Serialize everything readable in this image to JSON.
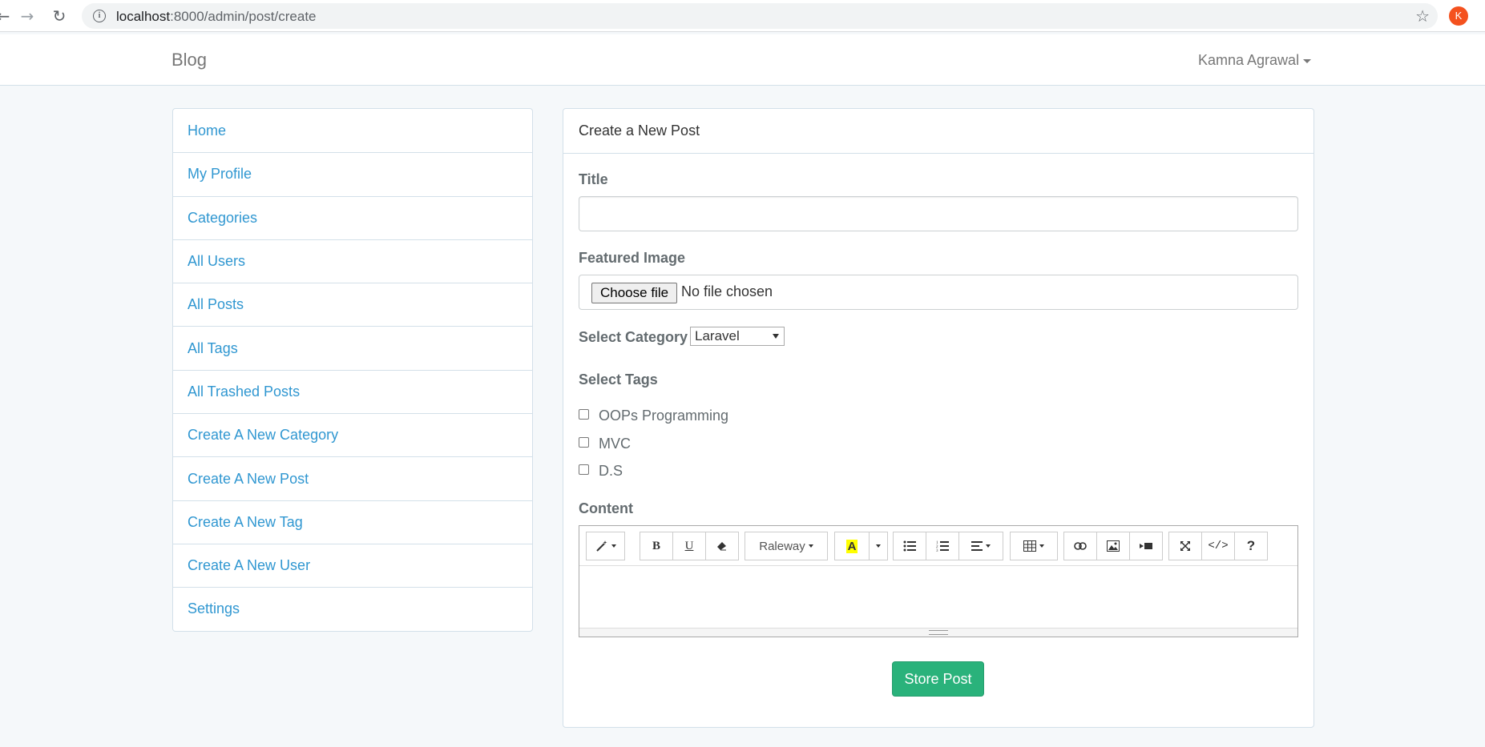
{
  "browser": {
    "url_host": "localhost",
    "url_path": ":8000/admin/post/create",
    "profile_initial": "K"
  },
  "navbar": {
    "brand": "Blog",
    "user_name": "Kamna Agrawal"
  },
  "sidebar": {
    "items": [
      {
        "label": "Home"
      },
      {
        "label": "My Profile"
      },
      {
        "label": "Categories"
      },
      {
        "label": "All Users"
      },
      {
        "label": "All Posts"
      },
      {
        "label": "All Tags"
      },
      {
        "label": "All Trashed Posts"
      },
      {
        "label": "Create A New Category"
      },
      {
        "label": "Create A New Post"
      },
      {
        "label": "Create A New Tag"
      },
      {
        "label": "Create A New User"
      },
      {
        "label": "Settings"
      }
    ]
  },
  "form": {
    "heading": "Create a New Post",
    "title_label": "Title",
    "title_value": "",
    "image_label": "Featured Image",
    "choose_file_label": "Choose file",
    "file_status": "No file chosen",
    "category_label": "Select Category",
    "category_selected": "Laravel",
    "tags_label": "Select Tags",
    "tags": [
      {
        "label": "OOPs Programming",
        "checked": false
      },
      {
        "label": "MVC",
        "checked": false
      },
      {
        "label": "D.S",
        "checked": false
      }
    ],
    "content_label": "Content",
    "editor_font": "Raleway",
    "submit_label": "Store Post"
  },
  "colors": {
    "link": "#3097d1",
    "success": "#2ab27b",
    "page_bg": "#f5f8fa"
  }
}
